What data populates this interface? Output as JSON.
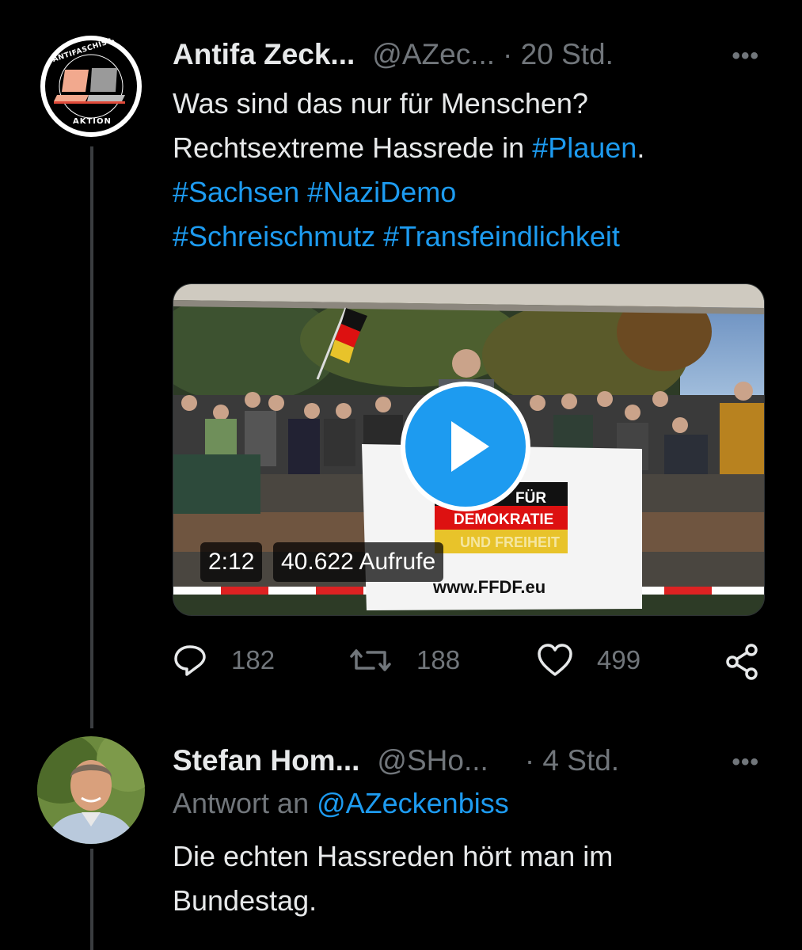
{
  "tweet1": {
    "avatar_text_top": "ANTIFASCHISTISCHE",
    "avatar_text_bottom": "AKTION",
    "name": "Antifa Zeck...",
    "handle": "@AZec...",
    "time": "· 20 Std.",
    "more": "•••",
    "text_line1": "Was sind das nur für Menschen?",
    "text_line2_a": "Rechtsextreme Hassrede in ",
    "text_line2_tag": "#Plauen",
    "text_line2_b": ".",
    "tag_sachsen": "#Sachsen",
    "tag_nazidemo": "#NaziDemo",
    "tag_schrei": "#Schreischmutz",
    "tag_trans": "#Transfeindlichkeit",
    "video": {
      "duration": "2:12",
      "views": "40.622 Aufrufe",
      "banner_line1": "FÜR",
      "banner_line2": "DEMOKRATIE",
      "banner_line3": "UND FREIHEIT",
      "banner_url": "www.FFDF.eu"
    },
    "actions": {
      "replies": "182",
      "retweets": "188",
      "likes": "499"
    }
  },
  "tweet2": {
    "name": "Stefan Hom...",
    "handle": "@SHo...",
    "time": "· 4 Std.",
    "more": "•••",
    "reply_prefix": "Antwort an ",
    "reply_to": "@AZeckenbiss",
    "text_line1": "Die echten Hassreden hört man im",
    "text_line2": "Bundestag."
  },
  "colors": {
    "background": "#000000",
    "link": "#1d9bf0",
    "secondary_text": "#71767b"
  },
  "icons": [
    "more-icon",
    "play-icon",
    "reply-icon",
    "retweet-icon",
    "like-icon",
    "share-icon"
  ]
}
